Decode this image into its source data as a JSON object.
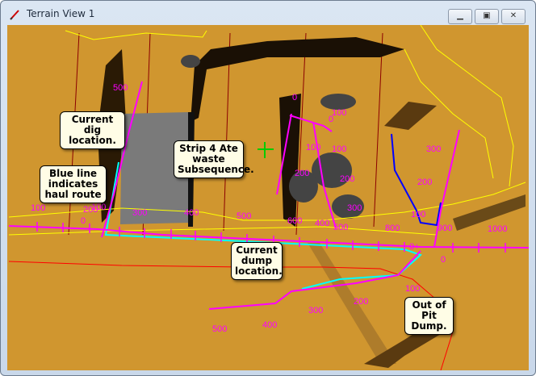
{
  "window": {
    "title": "Terrain View 1",
    "icon": "pencil-icon",
    "buttons": {
      "minimize": "minimize-icon",
      "maximize": "maximize-icon",
      "close": "close-icon"
    }
  },
  "colors": {
    "terrain": "#D0962F",
    "pit": "#7A7A7A",
    "haul_route": "#00FFFF",
    "road_centerline": "#FF00FF",
    "ramp": "#0000FF",
    "boundary": "#FFFF00",
    "gridline": "#8B0000",
    "dump_boundary": "#FF0000",
    "callout_bg": "#FFFDE6"
  },
  "callouts": [
    {
      "text": "Current dig\nlocation."
    },
    {
      "text": "Strip 4 Ate\nwaste\nSubsequence."
    },
    {
      "text": "Blue line\nindicates\nhaul route"
    },
    {
      "text": "Current\ndump\nlocation."
    },
    {
      "text": "Out of Pit\nDump."
    }
  ],
  "chainage_labels": [
    "500",
    "100",
    "200",
    "100",
    "0",
    "300",
    "400",
    "500",
    "0",
    "100",
    "0",
    "100",
    "100",
    "200",
    "200",
    "300",
    "600",
    "400",
    "500",
    "800",
    "100",
    "900",
    "1000",
    "300",
    "200",
    "0",
    "0+",
    "100",
    "200",
    "300",
    "400",
    "500"
  ]
}
